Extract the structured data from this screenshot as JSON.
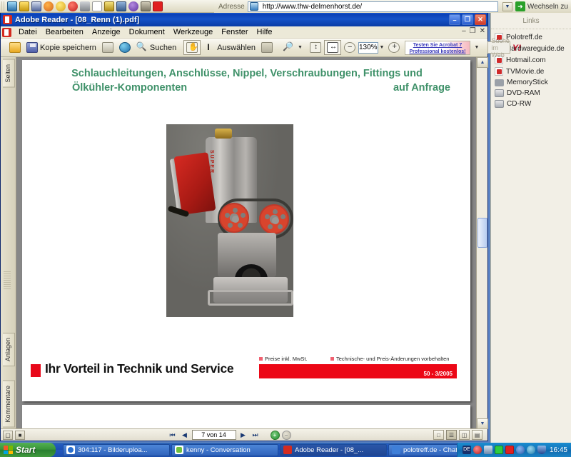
{
  "browser": {
    "address_label": "Adresse",
    "address_value": "http://www.thw-delmenhorst.de/",
    "go_label": "Wechseln zu",
    "quicklaunch_icons": [
      "globe-icon",
      "person-icon",
      "book-icon",
      "firefox-icon",
      "smiley-icon",
      "opera-icon",
      "link-icon",
      "page-icon",
      "pencil-icon",
      "mail-icon",
      "media-icon",
      "camera-icon",
      "hash-icon"
    ]
  },
  "links_pane": {
    "title": "Links",
    "items": [
      {
        "label": "Polotreff.de",
        "icon": "ie-page-icon"
      },
      {
        "label": "Hardwareguide.de",
        "icon": "ie-page-icon"
      },
      {
        "label": "Hotmail.com",
        "icon": "ie-page-icon"
      },
      {
        "label": "TVMovie.de",
        "icon": "ie-page-icon"
      },
      {
        "label": "MemoryStick",
        "icon": "usb-drive-icon"
      },
      {
        "label": "DVD-RAM",
        "icon": "disc-drive-icon"
      },
      {
        "label": "CD-RW",
        "icon": "disc-drive-icon"
      }
    ]
  },
  "reader": {
    "title": "Adobe Reader - [08_Renn (1).pdf]",
    "window_buttons": {
      "minimize": "–",
      "maximize": "❐",
      "close": "✕"
    },
    "mdi_buttons": {
      "minimize": "–",
      "restore": "❐",
      "close": "✕"
    },
    "menu": [
      "Datei",
      "Bearbeiten",
      "Anzeige",
      "Dokument",
      "Werkzeuge",
      "Fenster",
      "Hilfe"
    ],
    "toolbar": {
      "open_label": "",
      "save_copy_label": "Kopie speichern",
      "print_label": "",
      "email_label": "",
      "search_label": "Suchen",
      "hand_label": "",
      "select_label": "Auswählen",
      "snapshot_label": "",
      "zoom_label": "",
      "zoom_value": "130%",
      "pages_label": "",
      "help_label": "Hilfe",
      "web_search_placeholder": "Suche im Web",
      "yahoo_label": "Y!",
      "promo_line1": "Testen Sie Acrobat 7",
      "promo_line2": "Professional kostenlos!"
    },
    "nav_tabs": [
      "Seiten",
      "Anlagen",
      "Kommentare"
    ],
    "status": {
      "page_value": "7 von 14",
      "first_label": "⏮",
      "prev_label": "◀",
      "next_label": "▶",
      "last_label": "⏭",
      "zoom_in": "+",
      "zoom_out": "−",
      "view_buttons": [
        "single-page-icon",
        "continuous-icon",
        "facing-icon",
        "continuous-facing-icon"
      ]
    },
    "scrollbar": {
      "up": "▲",
      "down": "▼"
    }
  },
  "document": {
    "heading_line1": "Schlauchleitungen, Anschlüsse, Nippel, Verschraubungen, Fittings und",
    "heading_line2": "Ölkühler-Komponenten",
    "heading_right": "auf Anfrage",
    "heading_color": "#3f9169",
    "image_alt": "Rennmotor mit roten Zahnriemenrädern",
    "engine_text": "SUPER",
    "footer": {
      "title": "Ihr Vorteil in Technik und Service",
      "note_price": "Preise inkl. MwSt.",
      "note_changes": "Technische- und Preis-Änderungen vorbehalten",
      "page_code": "50 - 3/2005",
      "accent_color": "#ec0716"
    }
  },
  "taskbar": {
    "start_label": "Start",
    "buttons": [
      {
        "label": "304:117 - Bilderuploa...",
        "icon": "ie-icon",
        "active": false
      },
      {
        "label": "kenny - Conversation",
        "icon": "msn-icon",
        "active": false
      },
      {
        "label": "Adobe Reader - [08_...",
        "icon": "pdf-icon",
        "active": true
      },
      {
        "label": "polotreff.de - Chat v...",
        "icon": "ie-icon",
        "active": false
      }
    ],
    "tray_icons": [
      "language-icon",
      "modem-icon",
      "network-icon",
      "monitor-icon",
      "antivirus-icon",
      "update-icon",
      "sound-icon",
      "shield-icon"
    ],
    "clock": "16:45"
  }
}
